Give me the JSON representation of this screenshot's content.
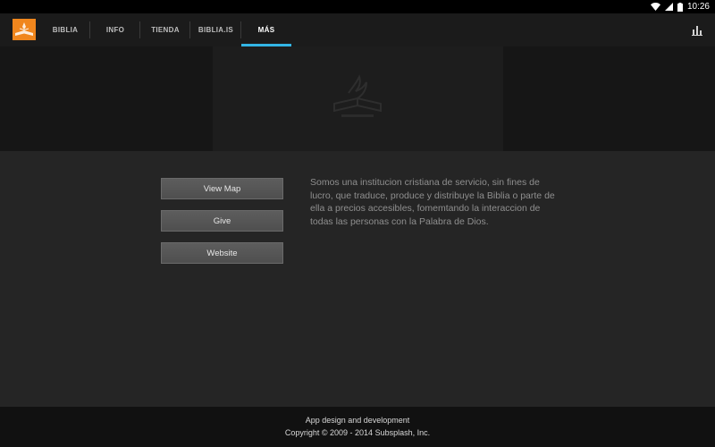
{
  "status_bar": {
    "time": "10:26",
    "icons": [
      "wifi-icon",
      "signal-icon",
      "battery-icon"
    ]
  },
  "action_bar": {
    "app_logo": "app-logo",
    "tabs": [
      {
        "label": "BIBLIA"
      },
      {
        "label": "INFO"
      },
      {
        "label": "TIENDA"
      },
      {
        "label": "BIBLIA.IS"
      },
      {
        "label": "MÁS",
        "selected": true
      }
    ],
    "right_icon": "bar-chart-icon",
    "accent_color": "#33b5e5",
    "brand_color": "#f0861d"
  },
  "banner": {
    "image": "bible-society-logo"
  },
  "buttons": {
    "view_map": "View Map",
    "give": "Give",
    "website": "Website"
  },
  "description": "Somos una institucion cristiana de servicio, sin fines de lucro, que traduce, produce y distribuye la Biblia o parte de ella a precios accesibles, fomemtando la interaccion de todas las personas con la Palabra de Dios.",
  "footer": {
    "line1": "App design and development",
    "line2": "Copyright © 2009 - 2014 Subsplash, Inc."
  }
}
